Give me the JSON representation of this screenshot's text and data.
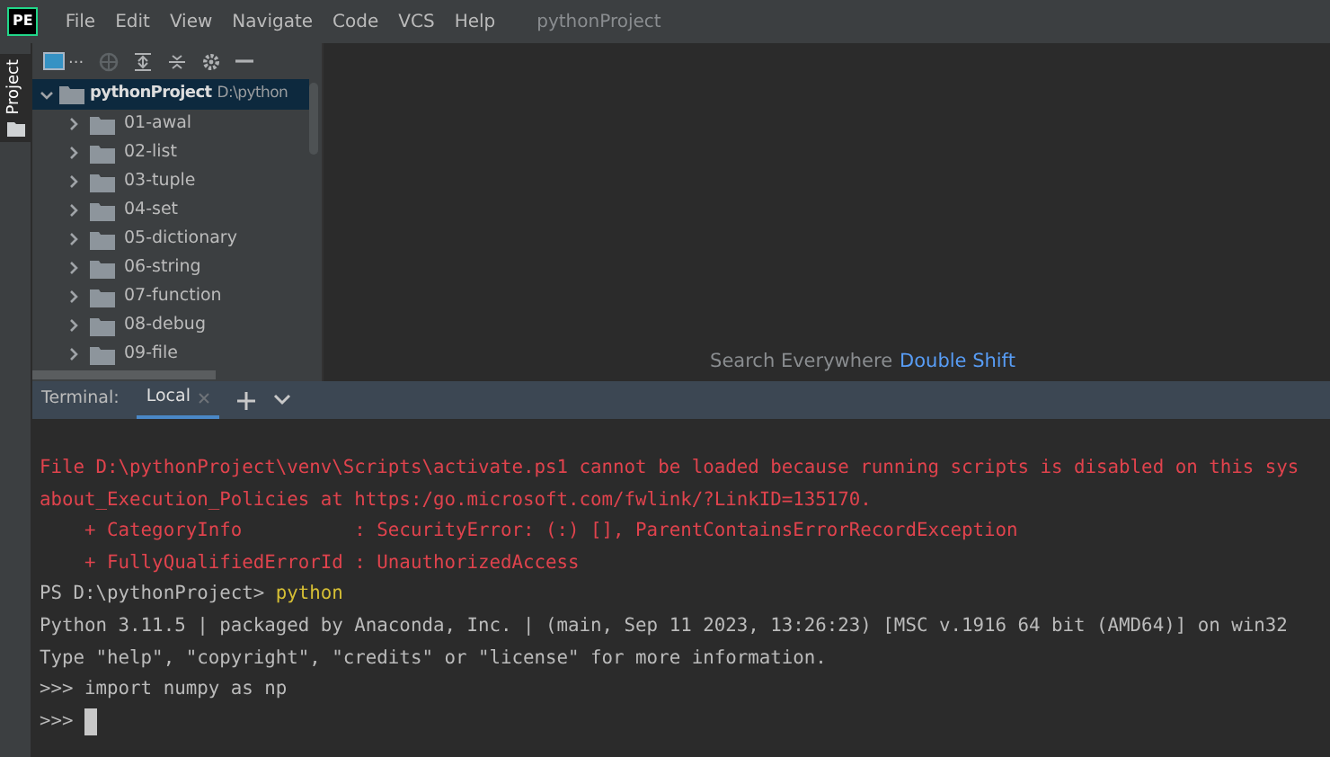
{
  "menu_bar": {
    "logo": "PE",
    "items": [
      "File",
      "Edit",
      "View",
      "Navigate",
      "Code",
      "VCS",
      "Help"
    ],
    "project_title": "pythonProject"
  },
  "side_strip": {
    "label": "Project"
  },
  "project_panel": {
    "toolbar": {
      "more": "..."
    },
    "root": {
      "name": "pythonProject",
      "path": "D:\\python",
      "expanded": true,
      "selected": true,
      "children": [
        {
          "name": "01-awal",
          "expanded": false
        },
        {
          "name": "02-list",
          "expanded": false
        },
        {
          "name": "03-tuple",
          "expanded": false
        },
        {
          "name": "04-set",
          "expanded": false
        },
        {
          "name": "05-dictionary",
          "expanded": false
        },
        {
          "name": "06-string",
          "expanded": false
        },
        {
          "name": "07-function",
          "expanded": false
        },
        {
          "name": "08-debug",
          "expanded": false
        },
        {
          "name": "09-file",
          "expanded": false
        }
      ]
    }
  },
  "editor_hint": {
    "text": "Search Everywhere",
    "shortcut": "Double Shift"
  },
  "terminal": {
    "label": "Terminal:",
    "tabs": [
      {
        "label": "Local",
        "selected": true
      }
    ],
    "lines": [
      {
        "segments": [
          {
            "kind": "error",
            "text": "File D:\\pythonProject\\venv\\Scripts\\activate.ps1 cannot be loaded because running scripts is disabled on this sys"
          }
        ]
      },
      {
        "segments": [
          {
            "kind": "error",
            "text": "about_Execution_Policies at https:/go.microsoft.com/fwlink/?LinkID=135170."
          }
        ]
      },
      {
        "segments": [
          {
            "kind": "error",
            "text": "    + CategoryInfo          : SecurityError: (:) [], ParentContainsErrorRecordException"
          }
        ]
      },
      {
        "segments": [
          {
            "kind": "error",
            "text": "    + FullyQualifiedErrorId : UnauthorizedAccess"
          }
        ]
      },
      {
        "segments": [
          {
            "kind": "plain",
            "text": "PS D:\\pythonProject> "
          },
          {
            "kind": "command",
            "text": "python"
          }
        ]
      },
      {
        "segments": [
          {
            "kind": "plain",
            "text": "Python 3.11.5 | packaged by Anaconda, Inc. | (main, Sep 11 2023, 13:26:23) [MSC v.1916 64 bit (AMD64)] on win32"
          }
        ]
      },
      {
        "segments": [
          {
            "kind": "plain",
            "text": "Type \"help\", \"copyright\", \"credits\" or \"license\" for more information."
          }
        ]
      },
      {
        "segments": [
          {
            "kind": "plain",
            "text": ">>> import numpy as np"
          }
        ]
      },
      {
        "segments": [
          {
            "kind": "plain",
            "text": ">>> "
          }
        ],
        "cursor": true
      }
    ]
  }
}
